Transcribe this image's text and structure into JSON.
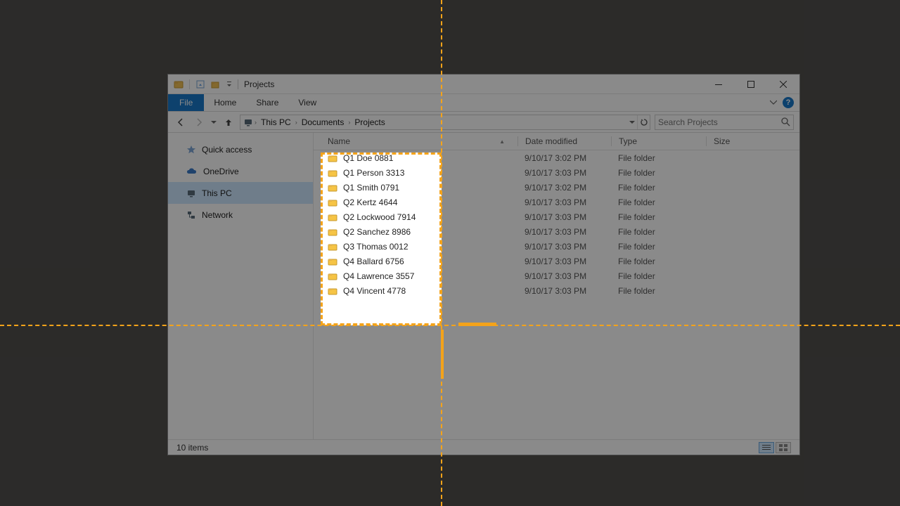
{
  "window": {
    "title": "Projects"
  },
  "ribbon": {
    "file": "File",
    "tabs": [
      "Home",
      "Share",
      "View"
    ]
  },
  "breadcrumbs": [
    "This PC",
    "Documents",
    "Projects"
  ],
  "search": {
    "placeholder": "Search Projects"
  },
  "navpane": {
    "items": [
      {
        "label": "Quick access",
        "icon": "star"
      },
      {
        "label": "OneDrive",
        "icon": "cloud"
      },
      {
        "label": "This PC",
        "icon": "pc",
        "selected": true
      },
      {
        "label": "Network",
        "icon": "network"
      }
    ]
  },
  "columns": {
    "name": "Name",
    "date": "Date modified",
    "type": "Type",
    "size": "Size"
  },
  "rows": [
    {
      "name": "Q1 Doe 0881",
      "date": "9/10/17 3:02 PM",
      "type": "File folder"
    },
    {
      "name": "Q1 Person 3313",
      "date": "9/10/17 3:03 PM",
      "type": "File folder"
    },
    {
      "name": "Q1 Smith 0791",
      "date": "9/10/17 3:02 PM",
      "type": "File folder"
    },
    {
      "name": "Q2 Kertz 4644",
      "date": "9/10/17 3:03 PM",
      "type": "File folder"
    },
    {
      "name": "Q2 Lockwood 7914",
      "date": "9/10/17 3:03 PM",
      "type": "File folder"
    },
    {
      "name": "Q2 Sanchez 8986",
      "date": "9/10/17 3:03 PM",
      "type": "File folder"
    },
    {
      "name": "Q3 Thomas 0012",
      "date": "9/10/17 3:03 PM",
      "type": "File folder"
    },
    {
      "name": "Q4 Ballard 6756",
      "date": "9/10/17 3:03 PM",
      "type": "File folder"
    },
    {
      "name": "Q4 Lawrence 3557",
      "date": "9/10/17 3:03 PM",
      "type": "File folder"
    },
    {
      "name": "Q4 Vincent 4778",
      "date": "9/10/17 3:03 PM",
      "type": "File folder"
    }
  ],
  "status": {
    "count": "10 items"
  }
}
